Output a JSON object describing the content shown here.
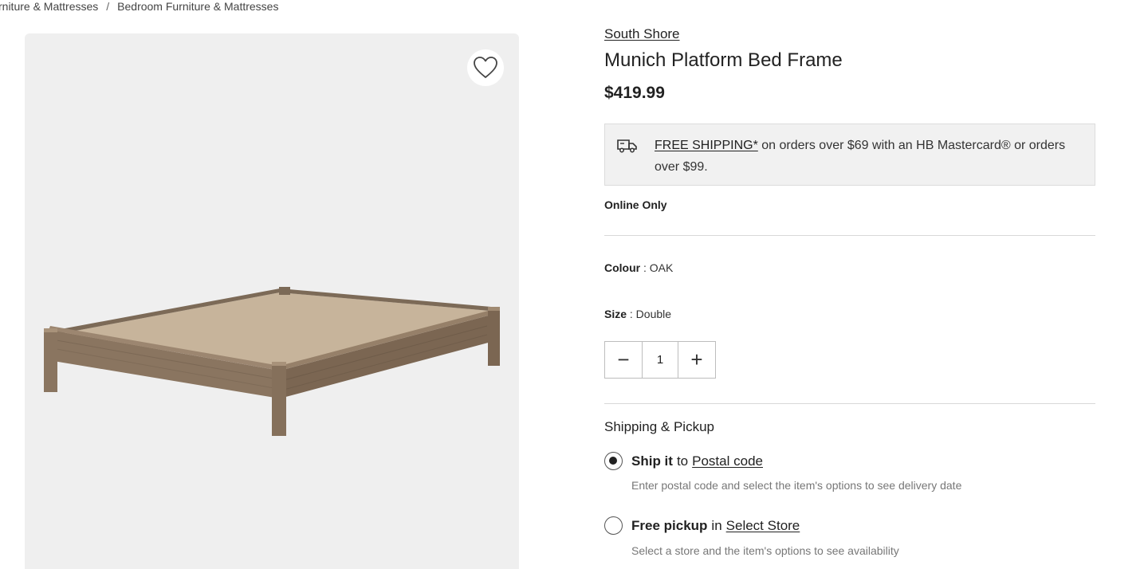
{
  "breadcrumb": {
    "items": [
      "rniture & Mattresses",
      "Bedroom Furniture & Mattresses"
    ],
    "separator": "/"
  },
  "gallery": {
    "wishlist_icon": "heart-outline-icon",
    "image_alt": "platform bed frame product image"
  },
  "product": {
    "brand": "South Shore",
    "title": "Munich Platform Bed Frame",
    "price": "$419.99"
  },
  "shipping_banner": {
    "icon": "truck-icon",
    "link_text": "FREE SHIPPING*",
    "text": " on orders over $69 with an HB Mastercard® or orders over $99."
  },
  "availability": "Online Only",
  "options": {
    "colour_label": "Colour",
    "colour_value": ": OAK",
    "size_label": "Size",
    "size_value": ": Double"
  },
  "quantity": {
    "minus": "−",
    "value": "1",
    "plus": "+"
  },
  "fulfillment": {
    "title": "Shipping & Pickup",
    "ship": {
      "strong": "Ship it",
      "mid": "to",
      "link": "Postal code",
      "helper": "Enter postal code and select the item's options to see delivery date",
      "selected": true
    },
    "pickup": {
      "strong": "Free pickup",
      "mid": "in",
      "link": "Select Store",
      "helper": "Select a store and the item's options to see availability",
      "selected": false
    }
  },
  "colors": {
    "gallery_bg": "#efefef",
    "wood": "#8a7560",
    "mattress_board": "#c7b49b"
  }
}
